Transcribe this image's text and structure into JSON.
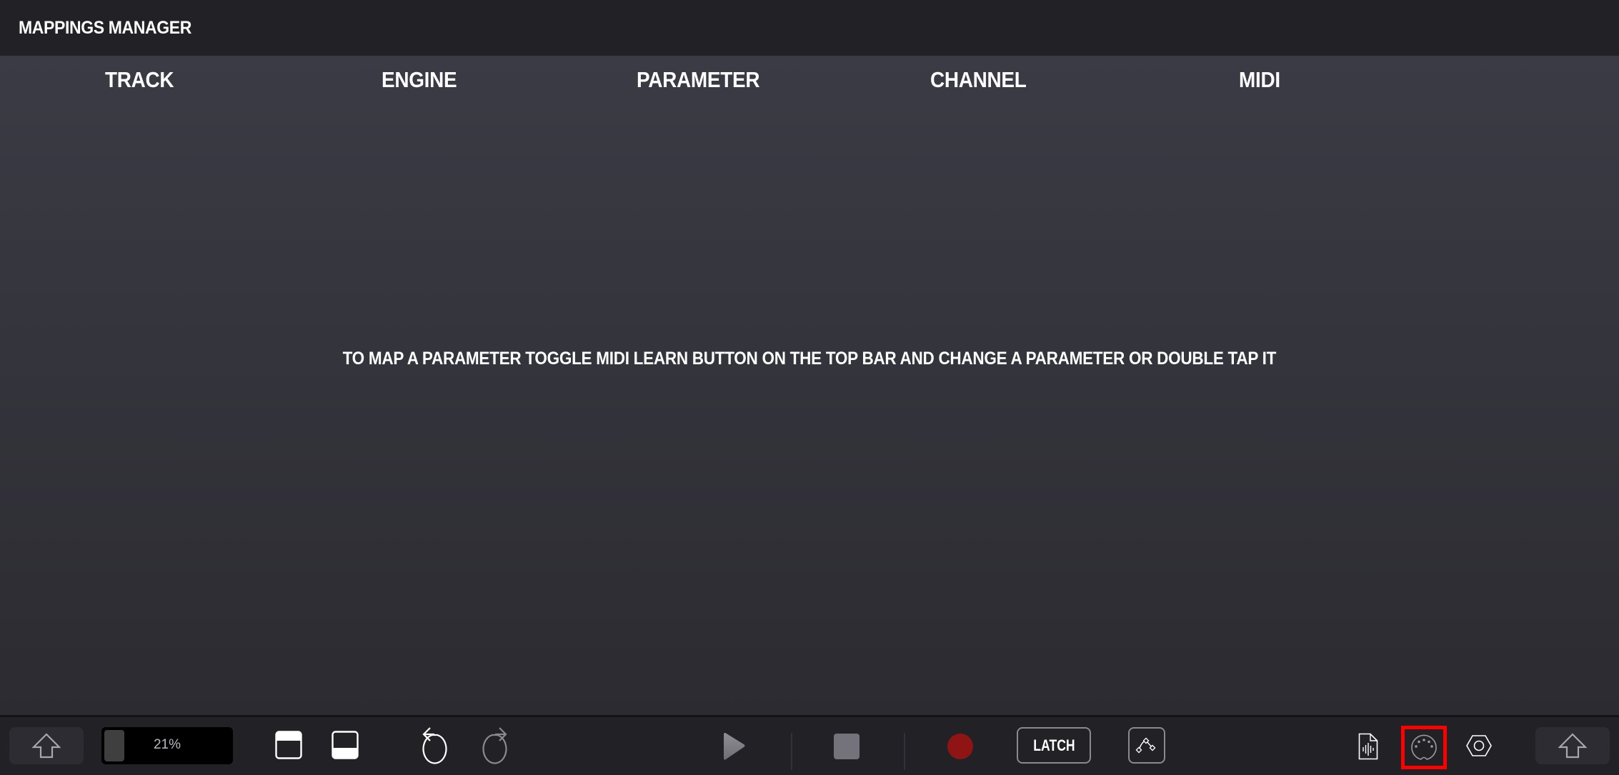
{
  "window": {
    "title": "MAPPINGS MANAGER"
  },
  "table": {
    "columns": [
      "TRACK",
      "ENGINE",
      "PARAMETER",
      "CHANNEL",
      "MIDI"
    ],
    "rows": [],
    "empty_message": "TO MAP A PARAMETER TOGGLE MIDI LEARN BUTTON ON THE TOP BAR AND CHANGE A PARAMETER OR DOUBLE TAP IT"
  },
  "bottombar": {
    "left_arrow_icon": "arrow-up-icon",
    "zoom": {
      "label": "21%",
      "value_percent": 21
    },
    "layout_top_icon": "panel-top-icon",
    "layout_bottom_icon": "panel-bottom-icon",
    "undo_icon": "undo-icon",
    "redo_icon": "redo-icon",
    "play_icon": "play-icon",
    "stop_icon": "stop-icon",
    "record_icon": "record-icon",
    "latch_label": "LATCH",
    "automation_icon": "automation-curve-icon",
    "audio_file_icon": "audio-file-icon",
    "midi_icon": "midi-din-icon",
    "settings_icon": "hex-nut-icon",
    "right_arrow_icon": "arrow-up-icon",
    "midi_highlighted": true
  },
  "colors": {
    "record": "#8f1515",
    "highlight": "#ff0000",
    "background_dark": "#222126",
    "content_top": "#3b3b45",
    "content_bottom": "#2c2b31"
  }
}
